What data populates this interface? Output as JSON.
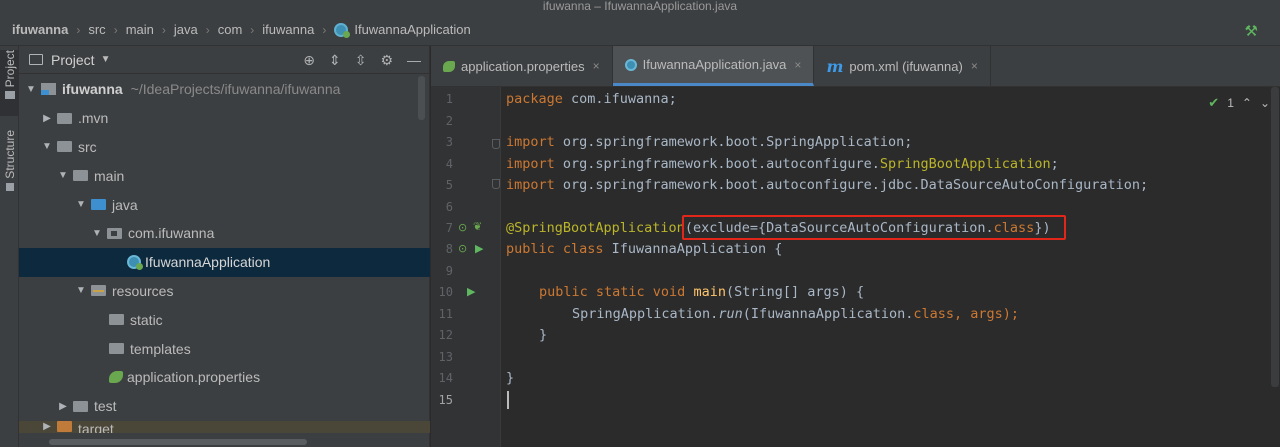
{
  "window": {
    "title": "ifuwanna – IfuwannaApplication.java"
  },
  "breadcrumbs": [
    "ifuwanna",
    "src",
    "main",
    "java",
    "com",
    "ifuwanna",
    "IfuwannaApplication"
  ],
  "toolstrip": {
    "project_tab": "Project",
    "structure_tab": "Structure"
  },
  "project_panel": {
    "title": "Project",
    "tree": [
      {
        "label": "ifuwanna",
        "path": "~/IdeaProjects/ifuwanna/ifuwanna"
      },
      {
        "label": ".mvn"
      },
      {
        "label": "src"
      },
      {
        "label": "main"
      },
      {
        "label": "java"
      },
      {
        "label": "com.ifuwanna"
      },
      {
        "label": "IfuwannaApplication"
      },
      {
        "label": "resources"
      },
      {
        "label": "static"
      },
      {
        "label": "templates"
      },
      {
        "label": "application.properties"
      },
      {
        "label": "test"
      },
      {
        "label": "target"
      }
    ]
  },
  "tabs": [
    {
      "label": "application.properties",
      "close": "×"
    },
    {
      "label": "IfuwannaApplication.java",
      "close": "×"
    },
    {
      "label": "pom.xml (ifuwanna)",
      "close": "×"
    }
  ],
  "editor": {
    "inspection_count": "1",
    "line_numbers": [
      "1",
      "2",
      "3",
      "4",
      "5",
      "6",
      "7",
      "8",
      "9",
      "10",
      "11",
      "12",
      "13",
      "14",
      "15"
    ],
    "lines": {
      "l1_kw": "package",
      "l1_rest": " com.ifuwanna;",
      "l3_kw": "import",
      "l3_rest": " org.springframework.boot.SpringApplication;",
      "l4_kw": "import",
      "l4_rest": " org.springframework.boot.autoconfigure.",
      "l4_ann": "SpringBootApplication",
      "l4_end": ";",
      "l5_kw": "import",
      "l5_rest": " org.springframework.boot.autoconfigure.jdbc.DataSourceAutoConfiguration;",
      "l7_ann": "@SpringBootApplication",
      "l7_rest": "(exclude={DataSourceAutoConfiguration.",
      "l7_kw": "class",
      "l7_end": "})",
      "l8_kw": "public class",
      "l8_rest": " IfuwannaApplication {",
      "l10_kw": "public static void",
      "l10_fn": "main",
      "l10_rest": "(String[] args) {",
      "l11_pre": "SpringApplication.",
      "l11_it": "run",
      "l11_mid": "(IfuwannaApplication.",
      "l11_kw": "class",
      "l11_end": ", args);",
      "l12": "}",
      "l14": "}"
    }
  }
}
